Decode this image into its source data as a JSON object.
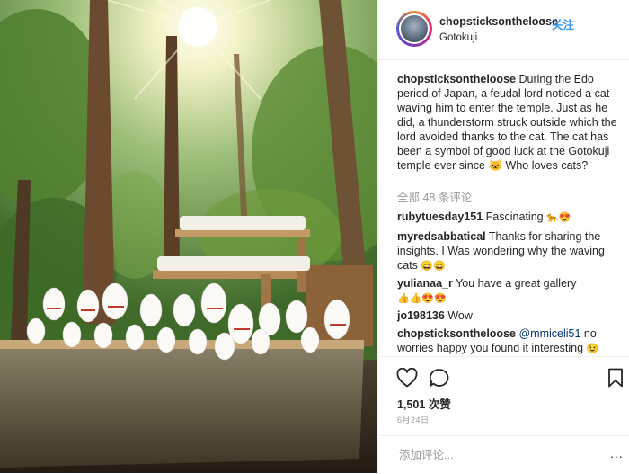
{
  "post": {
    "photo_alt": "Maneki-neko cat figurines on wooden shelves in a sunlit forest",
    "header": {
      "username": "chopsticksontheloose",
      "separator": "•",
      "follow_label": "关注",
      "location": "Gotokuji"
    },
    "caption": {
      "username": "chopsticksontheloose",
      "text_a": "During the Edo period of Japan, a feudal lord noticed a cat waving him to enter the temple. Just as he did, a thunderstorm struck outside which the lord avoided thanks to the cat. The cat has been a symbol of good luck at the Gotokuji temple ever since",
      "emoji": "🐱",
      "text_b": "Who loves cats?"
    },
    "view_all_comments": "全部 48 条评论",
    "comments": [
      {
        "username": "rubytuesday151",
        "text": "Fascinating",
        "emoji": "🐆😍"
      },
      {
        "username": "myredsabbatical",
        "text": "Thanks for sharing the insights. I Was wondering why the waving cats",
        "emoji": "😄😄"
      },
      {
        "username": "yulianaa_r",
        "text": "You have a great gallery",
        "emoji": "👍👍😍😍"
      },
      {
        "username": "jo198136",
        "text": "Wow",
        "emoji": ""
      },
      {
        "username": "chopsticksontheloose",
        "mention": "@mmiceli51",
        "text": "no worries happy you found it interesting",
        "emoji": "😉"
      }
    ],
    "likes": "1,501 次赞",
    "date": "6月24日",
    "add_comment_placeholder": "添加评论...",
    "more_options": "...",
    "icons": {
      "like": "heart-icon",
      "comment": "comment-bubble-icon",
      "save": "bookmark-icon",
      "avatar": "avatar"
    },
    "colors": {
      "follow": "#3897f0",
      "mention": "#003569",
      "muted": "#999999",
      "text": "#262626"
    }
  }
}
